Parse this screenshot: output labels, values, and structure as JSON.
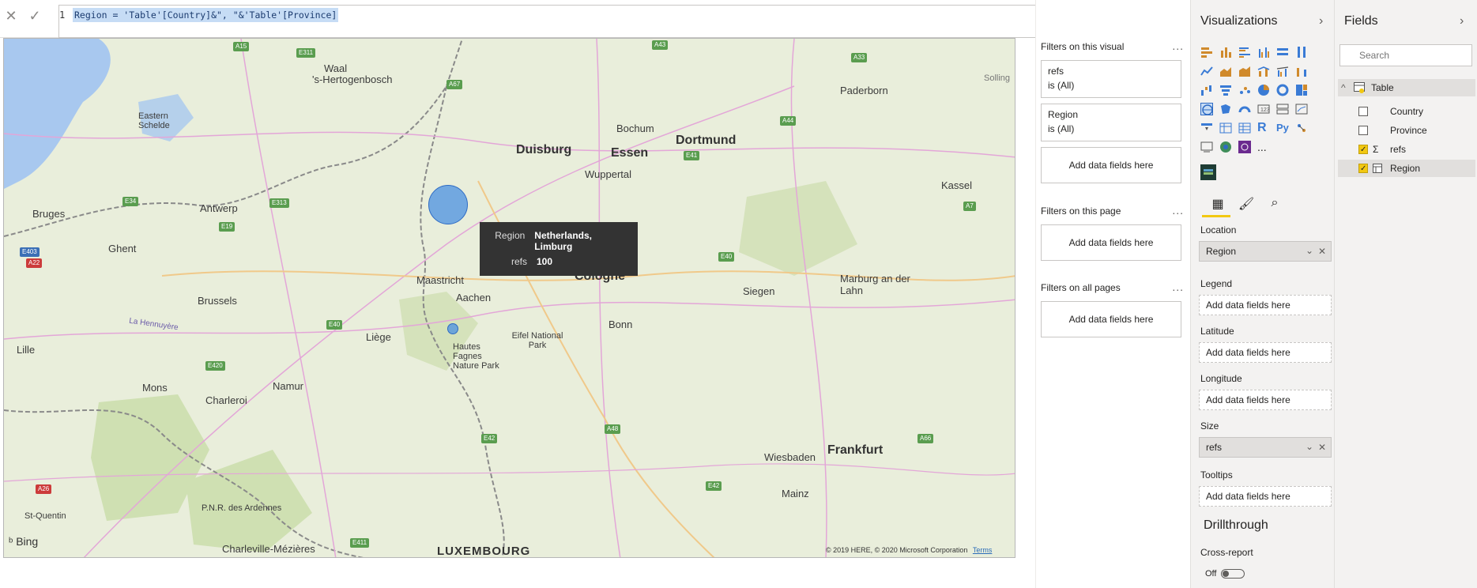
{
  "formula_bar": {
    "line_number": "1",
    "formula": "Region = 'Table'[Country]&\", \"&'Table'[Province]",
    "cancel_icon": "close-icon",
    "commit_icon": "check-icon"
  },
  "map": {
    "cities": [
      "Waal",
      "'s-Hertogenbosch",
      "Eastern Schelde",
      "Bruges",
      "Antwerp",
      "Ghent",
      "Brussels",
      "Lille",
      "Mons",
      "Charleroi",
      "Namur",
      "Liège",
      "Maastricht",
      "Aachen",
      "Duisburg",
      "Essen",
      "Dortmund",
      "Bochum",
      "Wuppertal",
      "Cologne",
      "Bonn",
      "Siegen",
      "Marburg an der Lahn",
      "Paderborn",
      "Kassel",
      "Eifel National Park",
      "Hautes Fagnes Nature Park",
      "Wiesbaden",
      "Frankfurt",
      "Mainz",
      "P.N.R. des Ardennes",
      "Charleville-Mézières",
      "St-Quentin",
      "La Hennuyère",
      "Solling"
    ],
    "country_label": "LUXEMBOURG",
    "bing_label": "Bing",
    "attribution": "© 2019 HERE, © 2020 Microsoft Corporation",
    "terms_label": "Terms"
  },
  "tooltip": {
    "region_label": "Region",
    "region_value": "Netherlands, Limburg",
    "refs_label": "refs",
    "refs_value": "100"
  },
  "filters": {
    "visual_header": "Filters on this visual",
    "visual_filters": [
      {
        "field": "refs",
        "state": "is (All)"
      },
      {
        "field": "Region",
        "state": "is (All)"
      }
    ],
    "add_label": "Add data fields here",
    "page_header": "Filters on this page",
    "all_pages_header": "Filters on all pages",
    "more": "..."
  },
  "visualizations": {
    "title": "Visualizations",
    "wells": {
      "location_label": "Location",
      "location_value": "Region",
      "legend_label": "Legend",
      "latitude_label": "Latitude",
      "longitude_label": "Longitude",
      "size_label": "Size",
      "size_value": "refs",
      "tooltips_label": "Tooltips",
      "placeholder": "Add data fields here"
    },
    "drillthrough_title": "Drillthrough",
    "cross_report_label": "Cross-report",
    "cross_report_state": "Off",
    "r_icon_label": "R",
    "py_icon_label": "Py",
    "more_icon_label": "..."
  },
  "fields": {
    "title": "Fields",
    "search_placeholder": "Search",
    "table_name": "Table",
    "items": [
      {
        "name": "Country",
        "checked": false
      },
      {
        "name": "Province",
        "checked": false
      },
      {
        "name": "refs",
        "checked": true
      },
      {
        "name": "Region",
        "checked": true
      }
    ]
  },
  "colors": {
    "accent": "#f2c811",
    "bubble": "#4a90e2",
    "tooltip_bg": "#333333"
  }
}
